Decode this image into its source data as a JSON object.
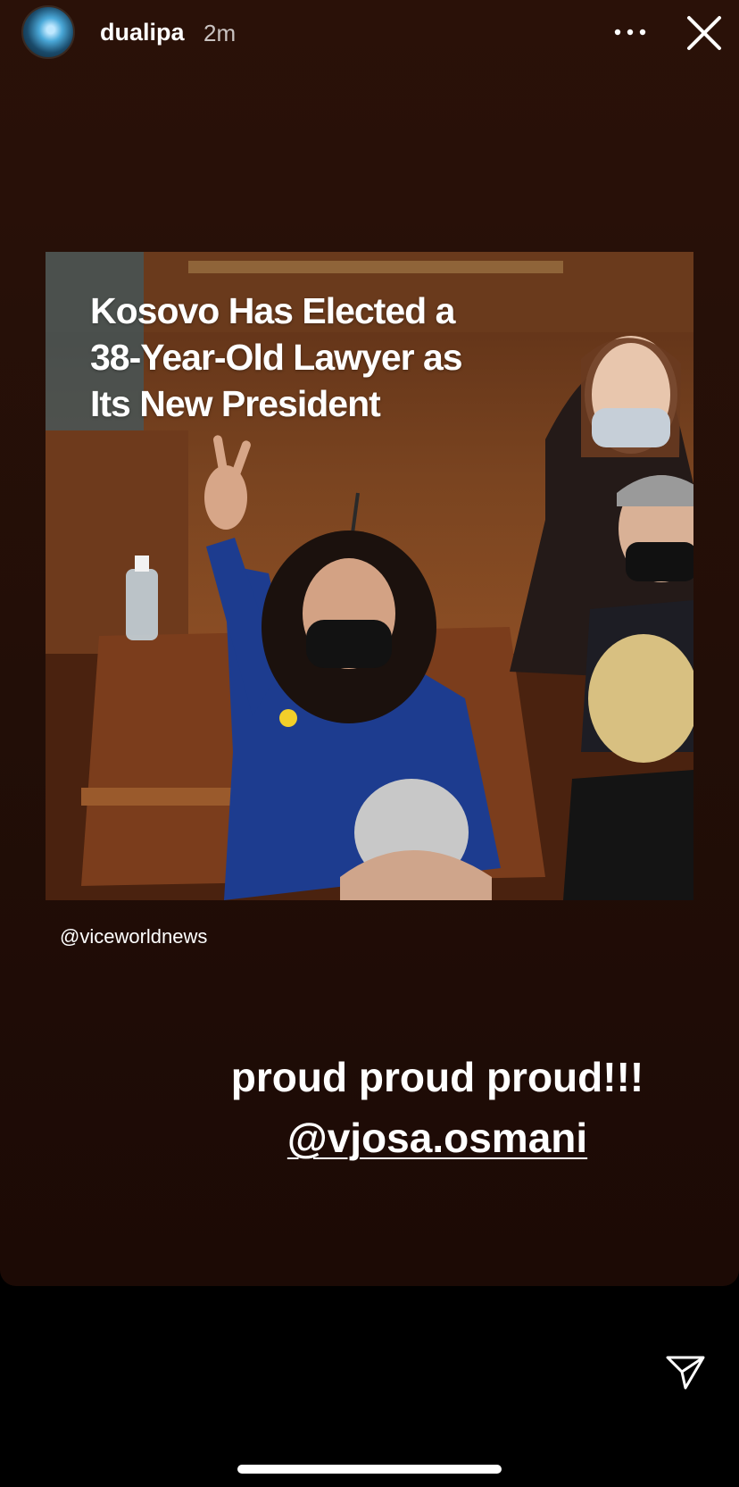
{
  "header": {
    "username": "dualipa",
    "time": "2m"
  },
  "icons": {
    "more": "more-options-icon",
    "close": "close-icon",
    "send": "send-icon"
  },
  "post": {
    "headline_lines": [
      "Kosovo Has Elected a",
      "38-Year-Old Lawyer as",
      "Its New President"
    ],
    "source": "@viceworldnews"
  },
  "caption": {
    "text": "proud proud proud!!!",
    "mention": "@vjosa.osmani"
  },
  "colors": {
    "background": "#230e07",
    "bottom_bar": "#000000",
    "text": "#ffffff"
  }
}
